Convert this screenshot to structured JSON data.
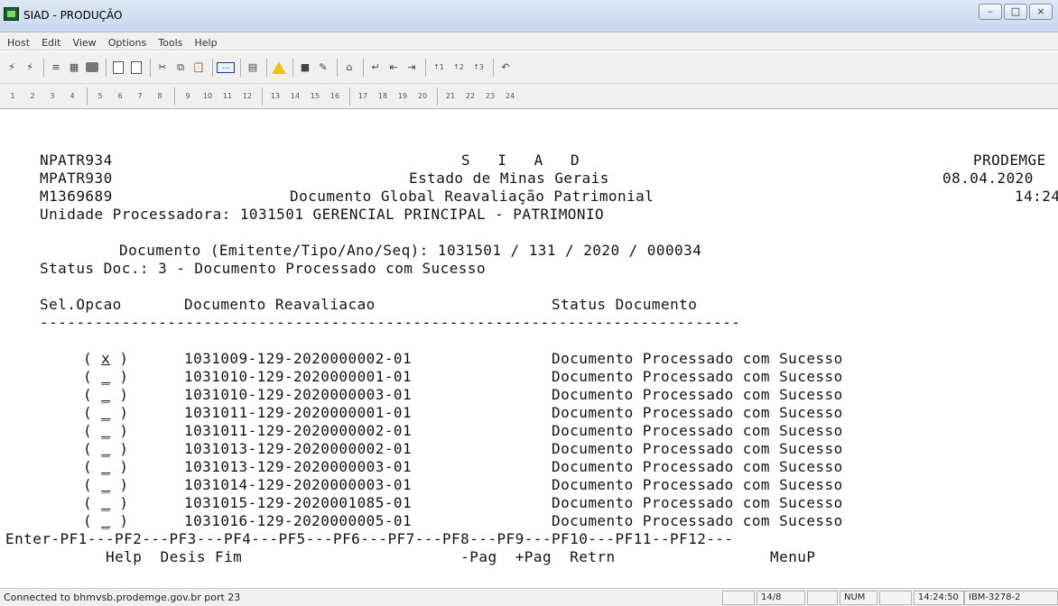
{
  "window": {
    "title": "SIAD - PRODUÇÃO"
  },
  "menu": {
    "items": [
      "Host",
      "Edit",
      "View",
      "Options",
      "Tools",
      "Help"
    ]
  },
  "toolbar2": {
    "pf_labels": [
      "1",
      "2",
      "3",
      "4",
      "5",
      "6",
      "7",
      "8",
      "9",
      "10",
      "11",
      "12",
      "13",
      "14",
      "15",
      "16",
      "17",
      "18",
      "19",
      "20",
      "21",
      "22",
      "23",
      "24"
    ]
  },
  "screen": {
    "header": {
      "prog1": "NPATR934",
      "system": "S   I   A   D",
      "org": "PRODEMGE",
      "prog2": "MPATR930",
      "state": "Estado de Minas Gerais",
      "date": "08.04.2020",
      "user": "M1369689",
      "doc_title": "Documento Global Reavaliação Patrimonial",
      "time": "14:24",
      "unit": "Unidade Processadora: 1031501 GERENCIAL PRINCIPAL - PATRIMONIO"
    },
    "document_line": "Documento (Emitente/Tipo/Ano/Seq): 1031501 / 131 / 2020 / 000034",
    "status_line": "Status Doc.: 3 - Documento Processado com Sucesso",
    "columns": {
      "sel": "Sel.Opcao",
      "doc": "Documento Reavaliacao",
      "status": "Status Documento"
    },
    "divider": "-----------------------------------------------------------------------------",
    "rows": [
      {
        "sel": "x",
        "doc": "1031009-129-2020000002-01",
        "status": "Documento Processado com Sucesso"
      },
      {
        "sel": "_",
        "doc": "1031010-129-2020000001-01",
        "status": "Documento Processado com Sucesso"
      },
      {
        "sel": "_",
        "doc": "1031010-129-2020000003-01",
        "status": "Documento Processado com Sucesso"
      },
      {
        "sel": "_",
        "doc": "1031011-129-2020000001-01",
        "status": "Documento Processado com Sucesso"
      },
      {
        "sel": "_",
        "doc": "1031011-129-2020000002-01",
        "status": "Documento Processado com Sucesso"
      },
      {
        "sel": "_",
        "doc": "1031013-129-2020000002-01",
        "status": "Documento Processado com Sucesso"
      },
      {
        "sel": "_",
        "doc": "1031013-129-2020000003-01",
        "status": "Documento Processado com Sucesso"
      },
      {
        "sel": "_",
        "doc": "1031014-129-2020000003-01",
        "status": "Documento Processado com Sucesso"
      },
      {
        "sel": "_",
        "doc": "1031015-129-2020001085-01",
        "status": "Documento Processado com Sucesso"
      },
      {
        "sel": "_",
        "doc": "1031016-129-2020000005-01",
        "status": "Documento Processado com Sucesso"
      }
    ],
    "pf_bar": "Enter-PF1---PF2---PF3---PF4---PF5---PF6---PF7---PF8---PF9---PF10---PF11--PF12---",
    "pf_labels": "Help  Desis Fim                        -Pag  +Pag  Retrn                 MenuP"
  },
  "statusbar": {
    "message": "Connected to bhmvsb.prodemge.gov.br port 23",
    "cursor": "14/8",
    "num": "NUM",
    "clock": "14:24:50",
    "terminal_type": "IBM-3278-2"
  }
}
